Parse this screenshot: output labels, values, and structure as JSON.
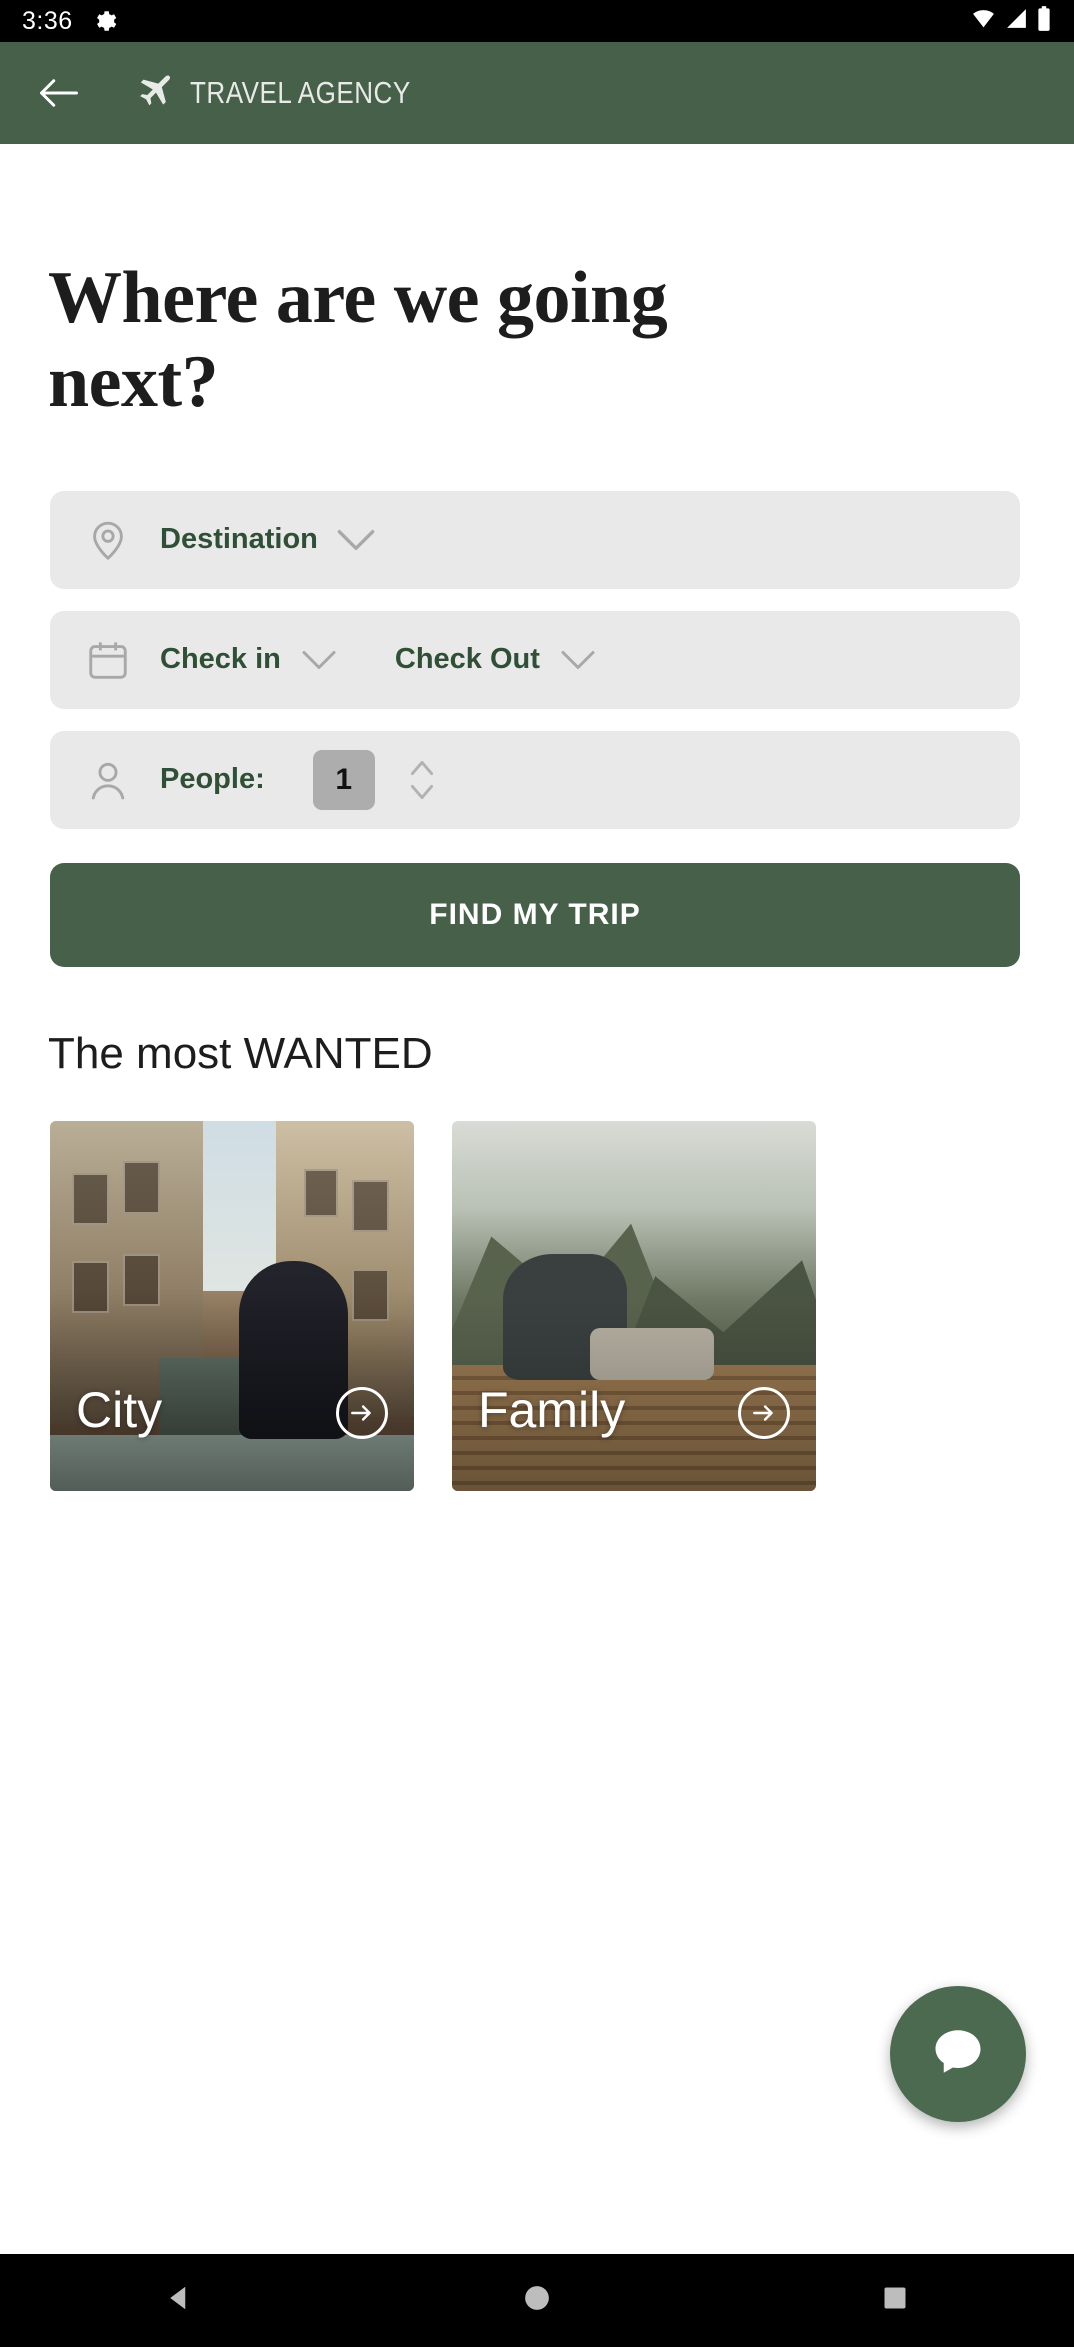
{
  "status_bar": {
    "time": "3:36",
    "gear_icon": "gear-icon",
    "wifi_icon": "wifi-icon",
    "signal_icon": "signal-icon",
    "battery_icon": "battery-icon",
    "background": "#000000"
  },
  "app_bar": {
    "back_icon": "arrow-left-icon",
    "plane_icon": "airplane-icon",
    "title": "TRAVEL AGENCY",
    "background": "#46604a",
    "title_color": "#e8eae8"
  },
  "main": {
    "headline": "Where are we going next?",
    "accent_color": "#2f4f36",
    "field_background": "#e9e9e9",
    "fields": [
      {
        "name": "destination",
        "icon": "map-pin-icon",
        "label": "Destination",
        "chevron": "chevron-down-icon"
      },
      {
        "name": "dates",
        "icon": "calendar-icon",
        "label_in": "Check in",
        "label_out": "Check Out",
        "chevron": "chevron-down-icon"
      },
      {
        "name": "people",
        "icon": "person-icon",
        "label": "People:",
        "value": "1",
        "stepper_icon": "stepper-up-down-icon",
        "value_background": "#adadad"
      }
    ],
    "cta": {
      "label": "FIND MY TRIP",
      "background": "#46604a",
      "text_color": "#ffffff"
    },
    "section_title": "The most WANTED",
    "cards": [
      {
        "label": "City",
        "arrow_icon": "arrow-right-circle-icon",
        "photo": "venice-canal-photo"
      },
      {
        "label": "Family",
        "arrow_icon": "arrow-right-circle-icon",
        "photo": "mountain-deck-photo"
      }
    ]
  },
  "fab": {
    "icon": "chat-bubble-icon",
    "background": "#4b6a50"
  },
  "nav_bar": {
    "background": "#000000",
    "buttons": [
      {
        "name": "back",
        "icon": "nav-back-triangle-icon"
      },
      {
        "name": "home",
        "icon": "nav-home-circle-icon"
      },
      {
        "name": "recents",
        "icon": "nav-recents-square-icon"
      }
    ]
  }
}
